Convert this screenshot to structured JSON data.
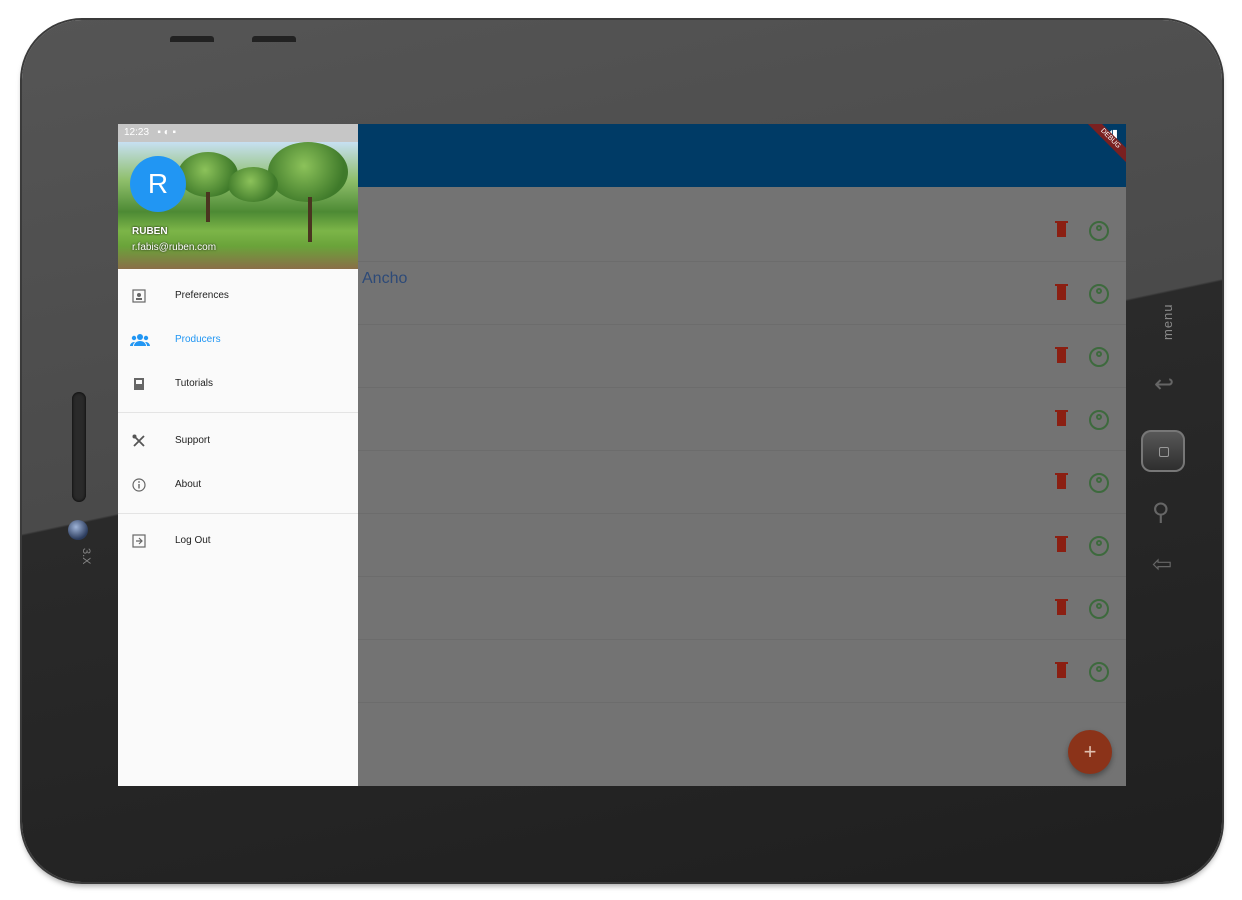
{
  "status_bar": {
    "time": "12:23"
  },
  "drawer": {
    "account": {
      "initial": "R",
      "name": "RUBEN",
      "email": "r.fabis@ruben.com"
    },
    "items": [
      {
        "label": "Preferences",
        "icon": "account-box-icon",
        "active": false
      },
      {
        "label": "Producers",
        "icon": "people-icon",
        "active": true
      },
      {
        "label": "Tutorials",
        "icon": "book-icon",
        "active": false
      },
      {
        "label": "Support",
        "icon": "tools-icon",
        "active": false
      },
      {
        "label": "About",
        "icon": "info-icon",
        "active": false
      },
      {
        "label": "Log Out",
        "icon": "logout-icon",
        "active": false
      }
    ]
  },
  "list": {
    "label": "Ancho",
    "rows": 8
  },
  "fab": {
    "label": "+"
  },
  "device": {
    "zoom_label": "3.X",
    "menu_label": "menu"
  },
  "colors": {
    "appbar": "#003b66",
    "accent": "#2196f3",
    "delete": "#8b1f12",
    "fab": "#8b3319"
  }
}
